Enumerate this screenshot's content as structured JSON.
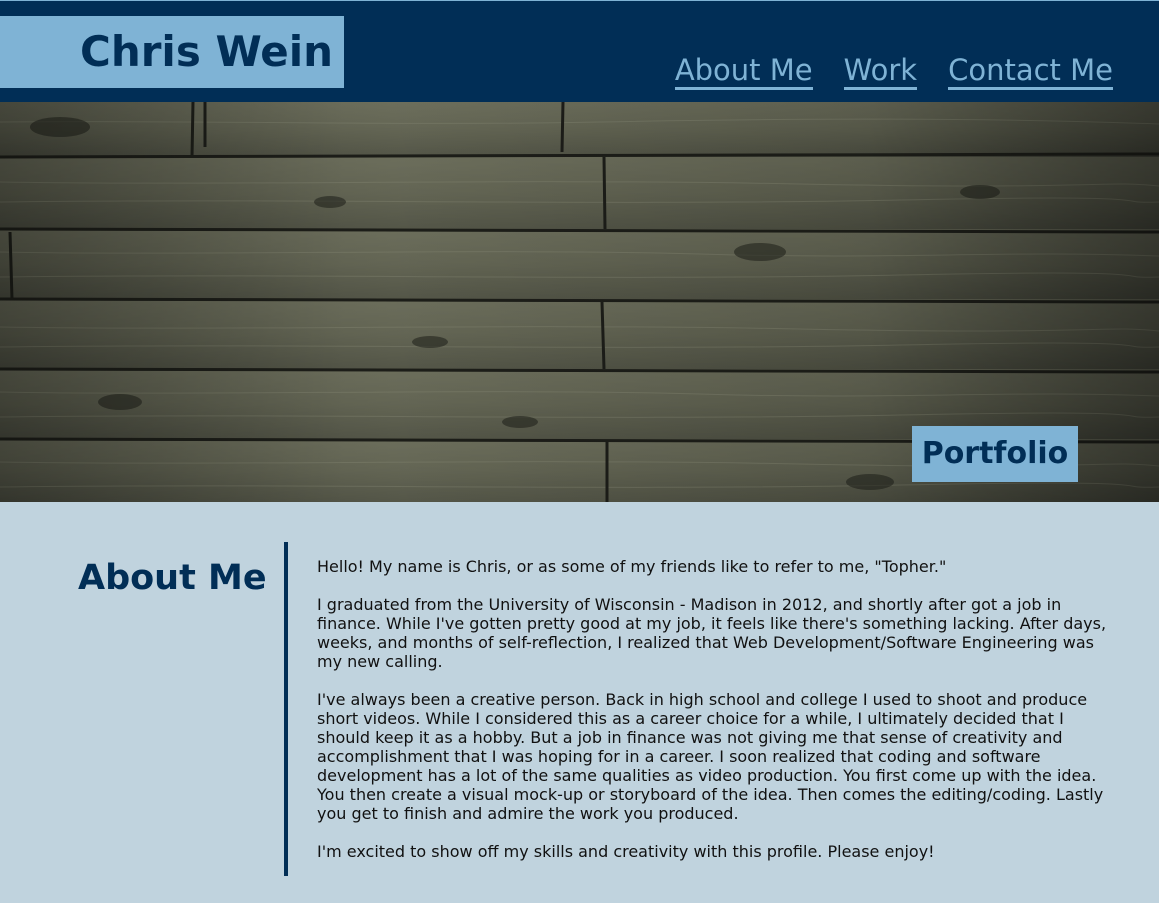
{
  "header": {
    "brand": "Chris Wein",
    "nav": [
      "About Me",
      "Work",
      "Contact Me"
    ]
  },
  "hero": {
    "badge": "Portfolio",
    "image": "weathered-wood-planks"
  },
  "about": {
    "heading": "About Me",
    "paragraphs": [
      "Hello! My name is Chris, or as some of my friends like to refer to me, \"Topher.\"",
      "I graduated from the University of Wisconsin - Madison in 2012, and shortly after got a job in finance. While I've gotten pretty good at my job, it feels like there's something lacking. After days, weeks, and months of self-reflection, I realized that Web Development/Software Engineering was my new calling.",
      "I've always been a creative person. Back in high school and college I used to shoot and produce short videos. While I considered this as a career choice for a while, I ultimately decided that I should keep it as a hobby. But a job in finance was not giving me that sense of creativity and accomplishment that I was hoping for in a career. I soon realized that coding and software development has a lot of the same qualities as video production. You first come up with the idea. You then create a visual mock-up or storyboard of the idea. Then comes the editing/coding. Lastly you get to finish and admire the work you produced.",
      "I'm excited to show off my skills and creativity with this profile. Please enjoy!"
    ]
  },
  "colors": {
    "navy": "#012e56",
    "light_blue": "#7fb3d5",
    "background": "#c0d3de"
  }
}
